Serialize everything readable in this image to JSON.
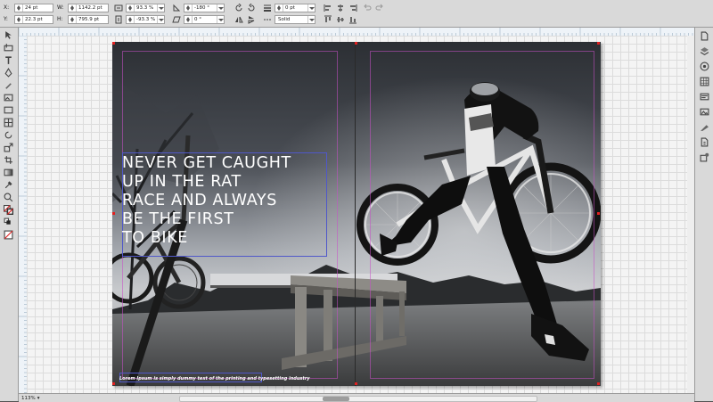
{
  "properties": {
    "x": {
      "label": "X:",
      "value": "24 pt"
    },
    "y": {
      "label": "Y:",
      "value": "22.3 pt"
    },
    "w": {
      "label": "W:",
      "value": "1142.2 pt"
    },
    "h": {
      "label": "H:",
      "value": "795.9 pt"
    },
    "scale_x": {
      "value": "93.3 %"
    },
    "scale_y": {
      "value": "-93.3 %"
    },
    "rotate": {
      "value": "-180 °"
    },
    "skew": {
      "value": "0 °"
    },
    "stroke_width": {
      "value": "0 pt"
    },
    "stroke_style": {
      "value": "Solid"
    }
  },
  "headline": {
    "lines": [
      "NEVER GET CAUGHT",
      "UP IN THE RAT",
      "RACE AND ALWAYS",
      "BE THE FIRST",
      "TO BIKE"
    ]
  },
  "caption": "Lorem Ipsum is simply dummy text of the printing and typesetting industry",
  "status": {
    "zoom": "113%"
  },
  "colors": {
    "chrome": "#d9d9d9",
    "workspace": "#545454",
    "frame_blue": "#5058c9",
    "margin_magenta": "#c850c8",
    "handle_red": "#e02020"
  },
  "icons": {
    "left": [
      "select-arrow-icon",
      "direct-select-icon",
      "text-icon",
      "pen-icon",
      "pencil-icon",
      "image-frame-icon",
      "rectangle-icon",
      "table-icon",
      "rotate-icon",
      "scale-icon",
      "crop-icon",
      "gradient-icon",
      "eyedropper-icon",
      "zoom-icon",
      "fill-stroke-icon",
      "swap-colors-icon",
      "no-color-icon"
    ],
    "right": [
      "page-icon",
      "layers-icon",
      "swatches-icon",
      "grid-icon",
      "styles-icon",
      "image-icon",
      "paint-icon",
      "info-icon",
      "settings-icon"
    ]
  }
}
